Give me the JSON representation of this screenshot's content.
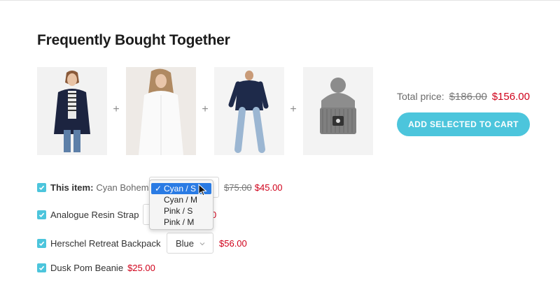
{
  "title": "Frequently Bought Together",
  "products": [
    {
      "alt": "woman in navy cardigan"
    },
    {
      "alt": "woman in white blouse"
    },
    {
      "alt": "man in navy hoodie"
    },
    {
      "alt": "grey pom beanie"
    }
  ],
  "plus_sign": "+",
  "total": {
    "label": "Total price:",
    "old_price": "$186.00",
    "new_price": "$156.00"
  },
  "cart_button": "ADD SELECTED TO CART",
  "items": [
    {
      "prefix": "This item:",
      "name": "Cyan Bohem",
      "variant": "Cyan / S",
      "old_price": "$75.00",
      "price": "$45.00"
    },
    {
      "name": "Analogue Resin Strap",
      "price_partial": "0"
    },
    {
      "name": "Herschel Retreat Backpack",
      "variant": "Blue",
      "price": "$56.00"
    },
    {
      "name": "Dusk Pom Beanie",
      "price": "$25.00"
    }
  ],
  "dropdown": {
    "options": [
      "Cyan / S",
      "Cyan / M",
      "Pink / S",
      "Pink / M"
    ],
    "selected_index": 0,
    "check": "✓"
  },
  "colors": {
    "accent": "#4cc5dc",
    "sale": "#d0021b",
    "highlight": "#2a7be4"
  }
}
